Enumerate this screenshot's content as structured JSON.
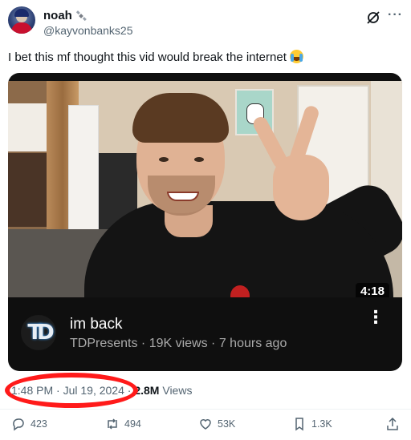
{
  "author": {
    "display_name": "noah",
    "handle": "@kayvonbanks25"
  },
  "icons": {
    "verified": "satellite-icon",
    "grok": "grok-icon",
    "more": "more-icon"
  },
  "tweet": {
    "text": "I bet this mf thought this vid would break the internet"
  },
  "video_card": {
    "duration": "4:18",
    "title": "im back",
    "channel": "TDPresents",
    "views": "19K views",
    "age": "7 hours ago",
    "meta_separator": " · ",
    "channel_initials": "TD"
  },
  "post_meta": {
    "time": "1:48 PM",
    "date": "Jul 19, 2024",
    "views_count": "2.8M",
    "views_label": "Views"
  },
  "actions": {
    "replies": "423",
    "reposts": "494",
    "likes": "53K",
    "bookmarks": "1.3K"
  },
  "colors": {
    "annotation_circle": "#ff1a1a",
    "secondary_text": "#536471",
    "card_background": "#0f0f0f"
  }
}
